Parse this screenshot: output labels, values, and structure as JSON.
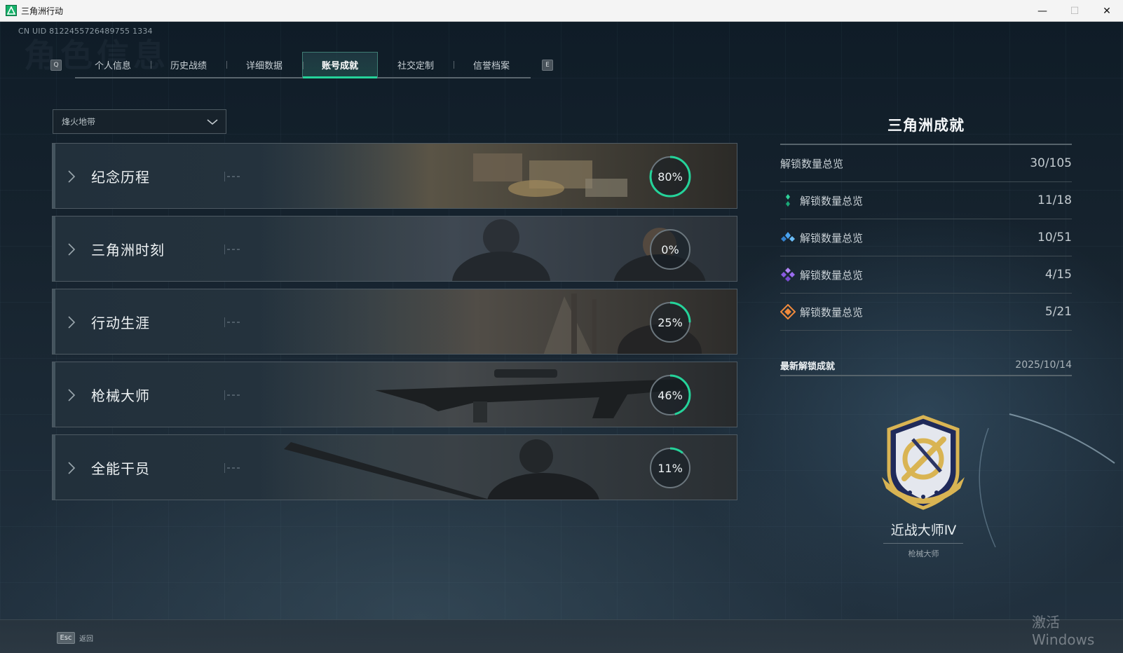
{
  "window": {
    "title": "三角洲行动",
    "minimize": "—",
    "maximize": "☐",
    "close": "✕"
  },
  "uid": "CN UID 8122455726489755 1334",
  "page_ghost_title": "角色信息",
  "tabs": {
    "prev_key": "Q",
    "next_key": "E",
    "items": [
      {
        "label": "个人信息"
      },
      {
        "label": "历史战绩"
      },
      {
        "label": "详细数据"
      },
      {
        "label": "账号成就",
        "active": true
      },
      {
        "label": "社交定制"
      },
      {
        "label": "信誉档案"
      }
    ]
  },
  "mode_dropdown": {
    "value": "烽火地带"
  },
  "categories": [
    {
      "label": "纪念历程",
      "percent": 80,
      "percent_text": "80%"
    },
    {
      "label": "三角洲时刻",
      "percent": 0,
      "percent_text": "0%"
    },
    {
      "label": "行动生涯",
      "percent": 25,
      "percent_text": "25%"
    },
    {
      "label": "枪械大师",
      "percent": 46,
      "percent_text": "46%"
    },
    {
      "label": "全能干员",
      "percent": 11,
      "percent_text": "11%"
    }
  ],
  "summary": {
    "title": "三角洲成就",
    "total": {
      "label": "解锁数量总览",
      "value": "30/105"
    },
    "rows": [
      {
        "label": "解锁数量总览",
        "value": "11/18",
        "icon": "green-gem-icon",
        "color": "#2fd39a"
      },
      {
        "label": "解锁数量总览",
        "value": "10/51",
        "icon": "blue-gem-icon",
        "color": "#4aa3f0"
      },
      {
        "label": "解锁数量总览",
        "value": "4/15",
        "icon": "purple-gem-icon",
        "color": "#9b6cf0"
      },
      {
        "label": "解锁数量总览",
        "value": "5/21",
        "icon": "orange-gem-icon",
        "color": "#f08a3c"
      }
    ]
  },
  "latest": {
    "label": "最新解锁成就",
    "date": "2025/10/14",
    "achievement_name": "近战大师Ⅳ",
    "achievement_category": "枪械大师"
  },
  "footer": {
    "esc_key": "Esc",
    "back_label": "返回"
  },
  "watermark": "激活 Windows",
  "colors": {
    "accent": "#25d39a",
    "ring_track": "#6b767d"
  }
}
